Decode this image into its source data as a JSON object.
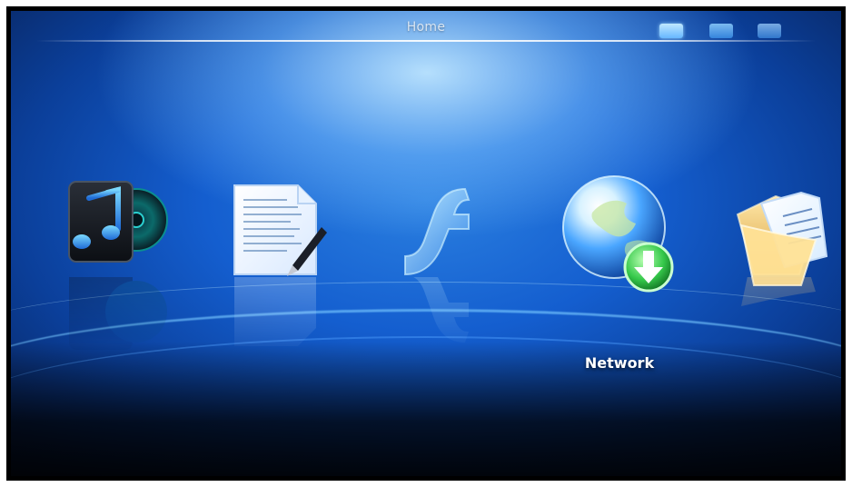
{
  "header": {
    "title": "Home",
    "status_icons": [
      {
        "name": "folder-icon",
        "active": true
      },
      {
        "name": "usb-icon",
        "active": false
      },
      {
        "name": "sd-card-icon",
        "active": false
      }
    ]
  },
  "menu": {
    "items": [
      {
        "icon": "music-icon",
        "label": ""
      },
      {
        "icon": "document-icon",
        "label": ""
      },
      {
        "icon": "flash-icon",
        "label": ""
      },
      {
        "icon": "network-globe-icon",
        "label": "Network",
        "selected": true
      },
      {
        "icon": "folder-files-icon",
        "label": ""
      }
    ]
  },
  "colors": {
    "background_blue": "#145ecf",
    "highlight": "#bfe7ff",
    "text": "#ffffff"
  }
}
